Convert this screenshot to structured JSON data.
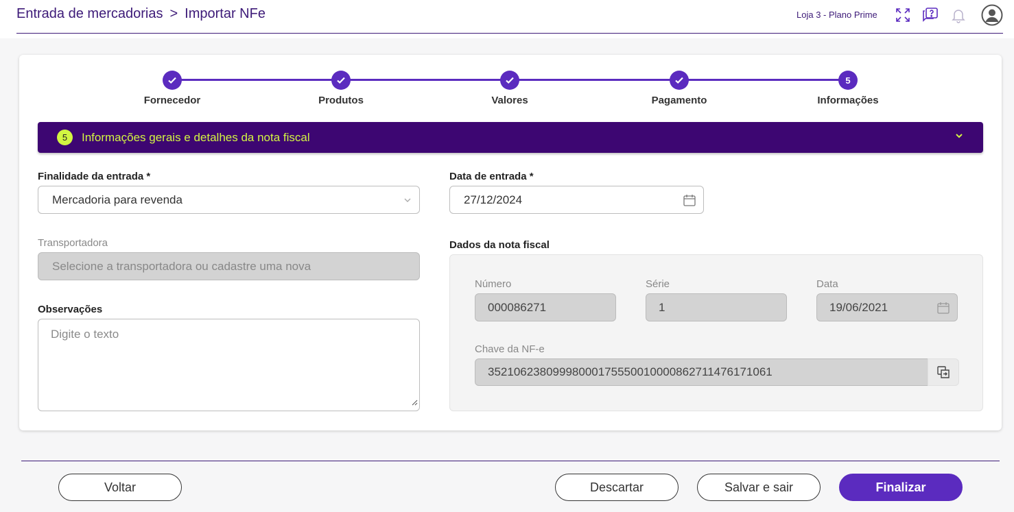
{
  "header": {
    "breadcrumb": [
      "Entrada de mercadorias",
      "Importar NFe"
    ],
    "breadcrumb_separator": ">",
    "store": "Loja 3 - Plano Prime",
    "icons": [
      "expand-icon",
      "help-chat-icon",
      "bell-icon",
      "user-avatar-icon"
    ]
  },
  "stepper": {
    "steps": [
      {
        "label": "Fornecedor",
        "status": "done"
      },
      {
        "label": "Produtos",
        "status": "done"
      },
      {
        "label": "Valores",
        "status": "done"
      },
      {
        "label": "Pagamento",
        "status": "done"
      },
      {
        "label": "Informações",
        "status": "current",
        "number": "5"
      }
    ]
  },
  "section": {
    "badge": "5",
    "title": "Informações gerais e detalhes da nota fiscal"
  },
  "form": {
    "finalidade_label": "Finalidade da entrada *",
    "finalidade_value": "Mercadoria para revenda",
    "data_entrada_label": "Data de entrada *",
    "data_entrada_value": "27/12/2024",
    "transportadora_label": "Transportadora",
    "transportadora_placeholder": "Selecione a transportadora ou cadastre uma nova",
    "observacoes_label": "Observações",
    "observacoes_placeholder": "Digite o texto"
  },
  "nota_fiscal": {
    "title": "Dados da nota fiscal",
    "numero_label": "Número",
    "numero_value": "000086271",
    "serie_label": "Série",
    "serie_value": "1",
    "data_label": "Data",
    "data_value": "19/06/2021",
    "chave_label": "Chave da NF-e",
    "chave_value": "35210623809998000175550010000862711476171061"
  },
  "footer": {
    "voltar": "Voltar",
    "descartar": "Descartar",
    "salvar": "Salvar e sair",
    "finalizar": "Finalizar"
  },
  "colors": {
    "primary": "#5b2bbf",
    "banner": "#3d0672",
    "accent": "#d2f542"
  }
}
